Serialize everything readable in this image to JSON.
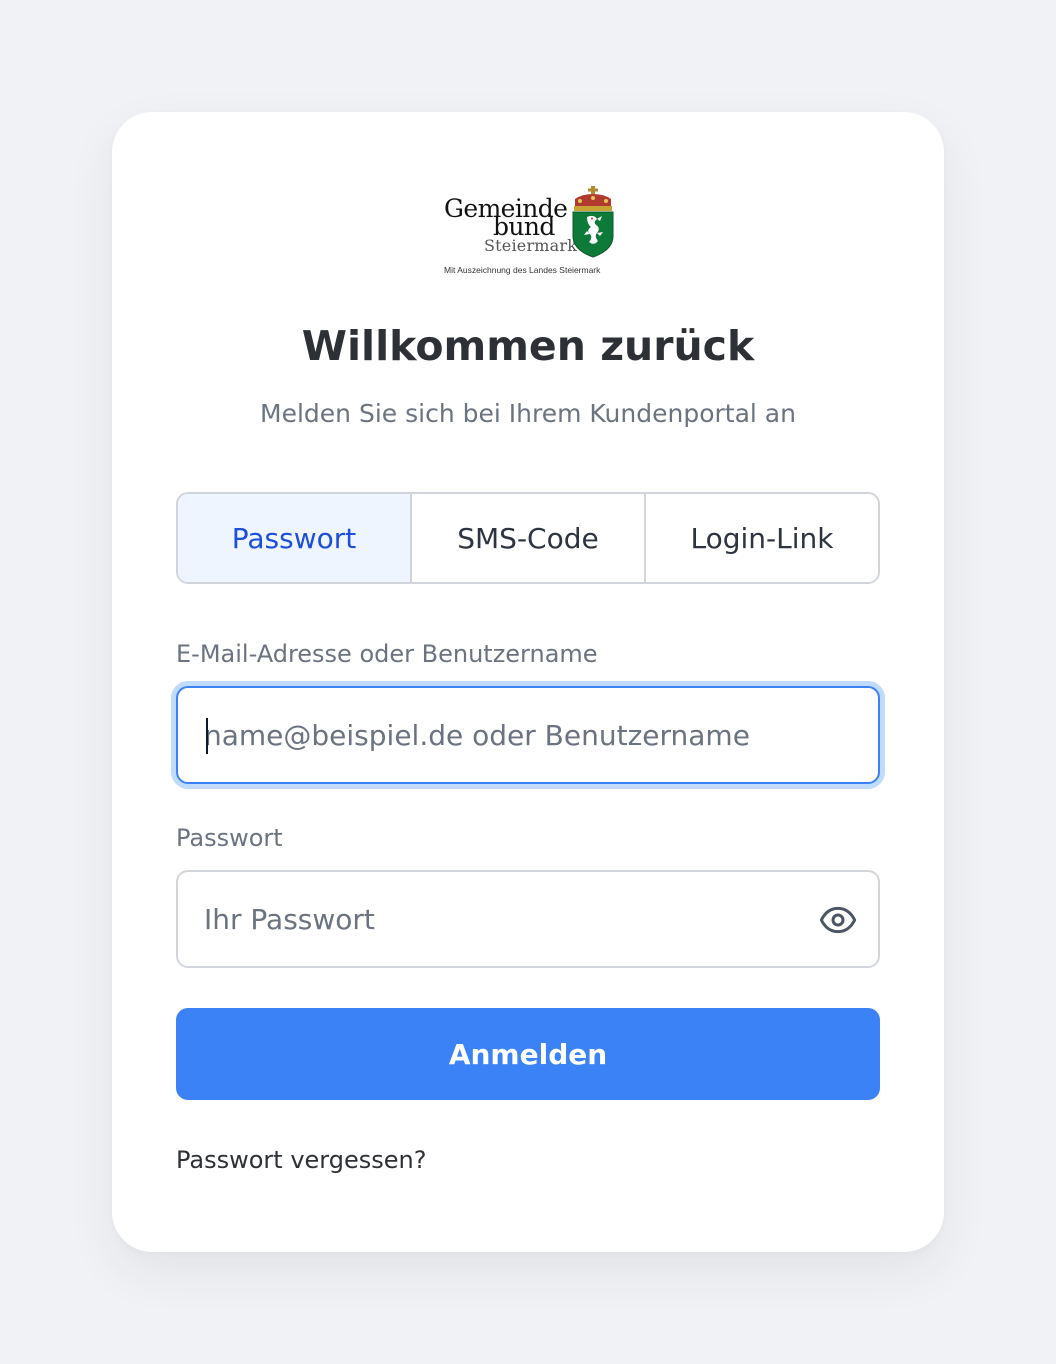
{
  "logo": {
    "line1": "Gemeinde",
    "line2": "bund",
    "line3": "Steiermark",
    "tagline": "Mit Auszeichnung des Landes Steiermark",
    "crest_icon": "styrian-panther-coat-of-arms-icon"
  },
  "title": "Willkommen zurück",
  "subtitle": "Melden Sie sich bei Ihrem Kundenportal an",
  "tabs": [
    {
      "label": "Passwort",
      "active": true
    },
    {
      "label": "SMS-Code",
      "active": false
    },
    {
      "label": "Login-Link",
      "active": false
    }
  ],
  "email": {
    "label": "E-Mail-Adresse oder Benutzername",
    "placeholder": "name@beispiel.de oder Benutzername",
    "value": "",
    "focused": true
  },
  "password": {
    "label": "Passwort",
    "placeholder": "Ihr Passwort",
    "value": "",
    "toggle_icon": "eye-icon"
  },
  "submit_label": "Anmelden",
  "forgot_label": "Passwort vergessen?",
  "colors": {
    "page_background": "#f1f2f5",
    "card_background": "#ffffff",
    "accent": "#3b82f6",
    "active_tab_text": "#1d4ed8",
    "active_tab_background": "#eef5ff",
    "focus_ring": "#bfdbfe",
    "crest_green": "#0e7a3a",
    "crest_red": "#c0392b"
  }
}
